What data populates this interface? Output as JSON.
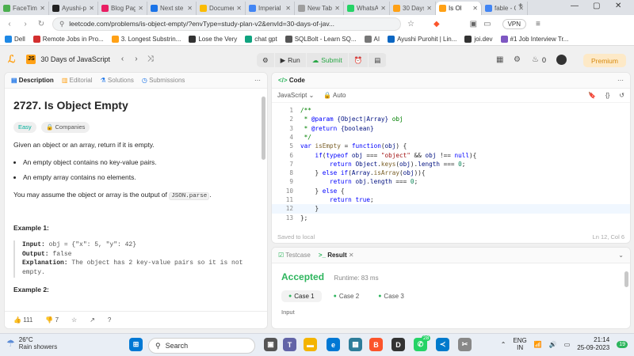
{
  "browser": {
    "tabs": [
      {
        "label": "FaceTim",
        "color": "#4caf50"
      },
      {
        "label": "Ayushi-p",
        "color": "#222222"
      },
      {
        "label": "Blog Pag",
        "color": "#e91e63"
      },
      {
        "label": "Next ste",
        "color": "#1a73e8"
      },
      {
        "label": "Documen",
        "color": "#fbbc04"
      },
      {
        "label": "Imperial",
        "color": "#4285f4"
      },
      {
        "label": "New Tab",
        "color": "#9e9e9e"
      },
      {
        "label": "WhatsAp",
        "color": "#25d366"
      },
      {
        "label": "30 Days",
        "color": "#ffa116"
      },
      {
        "label": "Is Ol",
        "color": "#ffa116"
      },
      {
        "label": "fable - G",
        "color": "#4285f4"
      }
    ],
    "url": "leetcode.com/problems/is-object-empty/?envType=study-plan-v2&envId=30-days-of-jav...",
    "vpn_label": "VPN"
  },
  "bookmarks": [
    {
      "label": "Dell",
      "color": "#1e88e5"
    },
    {
      "label": "Remote Jobs in Pro...",
      "color": "#d32f2f"
    },
    {
      "label": "3. Longest Substrin...",
      "color": "#ffa116"
    },
    {
      "label": "Lose the Very",
      "color": "#333333"
    },
    {
      "label": "chat gpt",
      "color": "#10a37f"
    },
    {
      "label": "SQLBolt - Learn SQ...",
      "color": "#555555"
    },
    {
      "label": "AI",
      "color": "#777777"
    },
    {
      "label": "Ayushi Purohit | Lin...",
      "color": "#0a66c2"
    },
    {
      "label": "joi.dev",
      "color": "#333333"
    },
    {
      "label": "#1 Job Interview Tr...",
      "color": "#7e57c2"
    }
  ],
  "leetcode": {
    "study_plan_title": "30 Days of JavaScript",
    "run_label": "Run",
    "submit_label": "Submit",
    "fire_count": "0",
    "premium_label": "Premium"
  },
  "description_panel": {
    "tabs": [
      "Description",
      "Editorial",
      "Solutions",
      "Submissions"
    ],
    "title": "2727. Is Object Empty",
    "difficulty": "Easy",
    "companies_label": "Companies",
    "intro": "Given an object or an array, return if it is empty.",
    "bullets": [
      "An empty object contains no key-value pairs.",
      "An empty array contains no elements."
    ],
    "assume_prefix": "You may assume the object or array is the output of ",
    "assume_code": "JSON.parse",
    "assume_suffix": ".",
    "example1_heading": "Example 1:",
    "example1": {
      "input_label": "Input:",
      "input_value": " obj = {\"x\": 5, \"y\": 42}",
      "output_label": "Output:",
      "output_value": " false",
      "explanation_label": "Explanation:",
      "explanation_value": " The object has 2 key-value pairs so it is not empty."
    },
    "example2_heading": "Example 2:",
    "likes": "111",
    "dislikes": "7"
  },
  "code_panel": {
    "title": "Code",
    "language": "JavaScript",
    "auto_label": "Auto",
    "status_left": "Saved to local",
    "status_right": "Ln 12, Col 6",
    "line_numbers": [
      "1",
      "2",
      "3",
      "4",
      "5",
      "6",
      "7",
      "8",
      "9",
      "10",
      "11",
      "12",
      "13"
    ]
  },
  "result_panel": {
    "tabs": [
      "Testcase",
      "Result"
    ],
    "status": "Accepted",
    "runtime": "Runtime: 83 ms",
    "cases": [
      "Case 1",
      "Case 2",
      "Case 3"
    ],
    "input_label": "Input"
  },
  "taskbar": {
    "weather_temp": "26°C",
    "weather_desc": "Rain showers",
    "search_placeholder": "Search",
    "lang_line1": "ENG",
    "lang_line2": "IN",
    "time": "21:14",
    "date": "25-09-2023",
    "chat_badge": "28",
    "notif_badge": "19"
  }
}
